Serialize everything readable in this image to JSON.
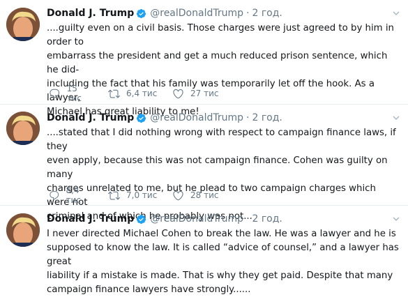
{
  "colors": {
    "text": "#14171a",
    "secondary": "#657786",
    "verified": "#1da1f2",
    "divider": "#e6ecf0"
  },
  "tweets": [
    {
      "name": "Donald J. Trump",
      "handle": "@realDonaldTrump",
      "separator": "·",
      "time": "2 год.",
      "text": "....guilty even on a civil basis. Those charges were just agreed to by him in order to\nembarrass the president and get a much reduced prison sentence, which he did-\nincluding the fact that his family was temporarily let off the hook. As a lawyer,\nMichael has great liability to me!",
      "replies": "15 тис",
      "retweets": "6,4 тис",
      "likes": "27 тис"
    },
    {
      "name": "Donald J. Trump",
      "handle": "@realDonaldTrump",
      "separator": "·",
      "time": "2 год.",
      "text": "....stated that I did nothing wrong with respect to campaign finance laws, if they\neven apply, because this was not campaign finance. Cohen was guilty on many\ncharges unrelated to me, but he plead to two campaign charges which were not\ncriminal and of which he probably was not...",
      "replies": "8,4 тис",
      "retweets": "7,0 тис",
      "likes": "28 тис"
    },
    {
      "name": "Donald J. Trump",
      "handle": "@realDonaldTrump",
      "separator": "·",
      "time": "2 год.",
      "text": "I never directed Michael Cohen to break the law. He was a lawyer and he is\nsupposed to know the law. It is called “advice of counsel,” and a lawyer has great\nliability if a mistake is made. That is why they get paid. Despite that many\ncampaign finance lawyers have strongly......"
    }
  ]
}
